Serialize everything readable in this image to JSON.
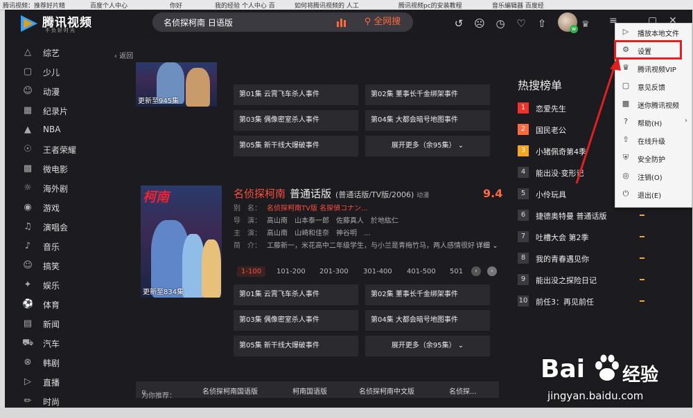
{
  "browser_tabs": [
    "腾讯视频：推荐好片精",
    "百度个人中心",
    "你好",
    "我的经验 个人中心 百",
    "如何将腾讯视频的 人工",
    "腾讯视频pc的安装教程",
    "音乐编辑器 百度经",
    ""
  ],
  "app": {
    "logo_text": "腾讯视频",
    "logo_slogan": "不负好时光",
    "search_value": "名侦探柯南 日语版",
    "search_button": "全网搜",
    "window_controls": [
      "≡",
      "▢",
      "✕"
    ]
  },
  "back_label": "返回",
  "sidebar": {
    "items": [
      {
        "label": "综艺",
        "icon": "variety-icon"
      },
      {
        "label": "少儿",
        "icon": "kids-icon"
      },
      {
        "label": "动漫",
        "icon": "anime-icon"
      },
      {
        "label": "纪录片",
        "icon": "documentary-icon"
      },
      {
        "label": "NBA",
        "icon": "nba-icon"
      },
      {
        "label": "王者荣耀",
        "icon": "game-king-icon"
      },
      {
        "label": "微电影",
        "icon": "micro-film-icon"
      },
      {
        "label": "海外剧",
        "icon": "overseas-icon"
      },
      {
        "label": "游戏",
        "icon": "game-icon"
      },
      {
        "label": "演唱会",
        "icon": "concert-icon"
      },
      {
        "label": "音乐",
        "icon": "music-icon"
      },
      {
        "label": "搞笑",
        "icon": "funny-icon"
      },
      {
        "label": "娱乐",
        "icon": "entertainment-icon"
      },
      {
        "label": "体育",
        "icon": "sports-icon"
      },
      {
        "label": "新闻",
        "icon": "news-icon"
      },
      {
        "label": "汽车",
        "icon": "car-icon"
      },
      {
        "label": "韩剧",
        "icon": "korean-drama-icon"
      },
      {
        "label": "直播",
        "icon": "live-icon"
      },
      {
        "label": "时尚",
        "icon": "fashion-icon"
      }
    ]
  },
  "result1": {
    "update": "更新至945集",
    "episodes": [
      "第01集 云霄飞车杀人事件",
      "第02集 董事长千金绑架事件",
      "第03集 偶像密室杀人事件",
      "第04集 大都会暗号地图事件",
      "第05集 新干线大爆破事件"
    ],
    "more": "展开更多（余95集）"
  },
  "result2": {
    "poster_brand": "柯南",
    "update": "更新至834集",
    "title": "名侦探柯南",
    "dub": "普通话版",
    "meta": "(普通话版/TV版/2006)",
    "genre": "动漫",
    "score": "9.4",
    "alias_key": "别　名：",
    "alias_value": "名侦探柯南TV版 名探偵コナン...",
    "director_key": "导　演：",
    "director_value": "高山南　山本泰一郎　佐藤真人　於地紘仁",
    "cast_key": "主　演：",
    "cast_value": "高山南　山崎和佳奈　神谷明　...",
    "intro_key": "简　介：",
    "intro_value": "工藤新一，米花高中二年级学生，与小兰是青梅竹马，两人感情很好",
    "detail": "详细",
    "ranges": [
      "1-100",
      "101-200",
      "201-300",
      "301-400",
      "401-500",
      "501"
    ],
    "episodes": [
      "第01集 云霄飞车杀人事件",
      "第02集 董事长千金绑架事件",
      "第03集 偶像密室杀人事件",
      "第04集 大都会暗号地图事件",
      "第05集 新干线大爆破事件"
    ],
    "more": "展开更多（余95集）"
  },
  "recommend": {
    "label": "为你推荐：",
    "items": [
      "名侦探柯南国语版",
      "柯南国语版",
      "名侦探柯南中文版",
      "名侦探..."
    ]
  },
  "hot": {
    "title": "热搜榜单",
    "items": [
      {
        "rank": "1",
        "name": "恋爱先生"
      },
      {
        "rank": "2",
        "name": "国民老公"
      },
      {
        "rank": "3",
        "name": "小猪佩奇第4季"
      },
      {
        "rank": "4",
        "name": "能出没·变形记"
      },
      {
        "rank": "5",
        "name": "小伶玩具"
      },
      {
        "rank": "6",
        "name": "捷德奥特曼 普通话版"
      },
      {
        "rank": "7",
        "name": "吐槽大会 第2季"
      },
      {
        "rank": "8",
        "name": "我的青春遇见你"
      },
      {
        "rank": "9",
        "name": "能出没之探险日记"
      },
      {
        "rank": "10",
        "name": "前任3：再见前任"
      }
    ]
  },
  "menu": {
    "items": [
      {
        "label": "播放本地文件",
        "icon": "play-icon"
      },
      {
        "label": "设置",
        "icon": "gear-icon"
      },
      {
        "label": "腾讯视频VIP",
        "icon": "vip-icon"
      },
      {
        "label": "意见反馈",
        "icon": "feedback-icon"
      },
      {
        "label": "迷你腾讯视频",
        "icon": "mini-icon"
      },
      {
        "label": "帮助(H)",
        "icon": "help-icon"
      },
      {
        "label": "在线升级",
        "icon": "upgrade-icon"
      },
      {
        "label": "安全防护",
        "icon": "shield-icon"
      },
      {
        "label": "注销(O)",
        "icon": "logout-icon"
      },
      {
        "label": "退出(E)",
        "icon": "power-icon"
      }
    ]
  },
  "watermark": {
    "brand": "Bai",
    "brand2": "经验",
    "url": "jingyan.baidu.com"
  },
  "colors": {
    "accent": "#ff4d3d",
    "orange": "#ff6a3d",
    "highlight": "#e02020"
  }
}
